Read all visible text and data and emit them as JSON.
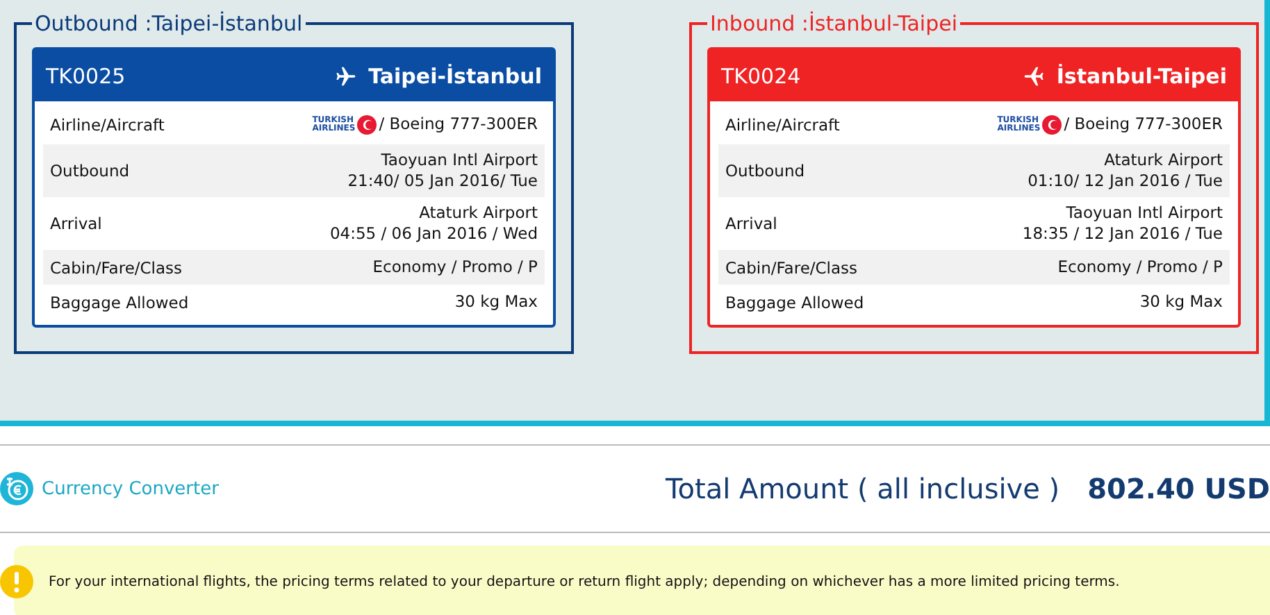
{
  "flights": [
    {
      "kind": "outbound",
      "legend": "Outbound :Taipei-İstanbul",
      "code": "TK0025",
      "route": "Taipei-İstanbul",
      "rows": [
        {
          "label": "Airline/Aircraft",
          "logo": {
            "line1": "TURKISH",
            "line2": "AIRLINES"
          },
          "lines": [
            "/ Boeing 777-300ER"
          ]
        },
        {
          "label": "Outbound",
          "lines": [
            "Taoyuan Intl Airport",
            "21:40/ 05 Jan 2016/ Tue"
          ]
        },
        {
          "label": "Arrival",
          "lines": [
            "Ataturk Airport",
            "04:55 / 06 Jan 2016 / Wed"
          ]
        },
        {
          "label": "Cabin/Fare/Class",
          "lines": [
            "Economy / Promo / P"
          ]
        },
        {
          "label": "Baggage Allowed",
          "lines": [
            "30 kg Max"
          ]
        }
      ]
    },
    {
      "kind": "inbound",
      "legend": "Inbound :İstanbul-Taipei",
      "code": "TK0024",
      "route": "İstanbul-Taipei",
      "rows": [
        {
          "label": "Airline/Aircraft",
          "logo": {
            "line1": "TURKISH",
            "line2": "AIRLINES"
          },
          "lines": [
            "/ Boeing 777-300ER"
          ]
        },
        {
          "label": "Outbound",
          "lines": [
            "Ataturk Airport",
            "01:10/ 12 Jan 2016 / Tue"
          ]
        },
        {
          "label": "Arrival",
          "lines": [
            "Taoyuan Intl Airport",
            "18:35 / 12 Jan 2016 / Tue"
          ]
        },
        {
          "label": "Cabin/Fare/Class",
          "lines": [
            "Economy / Promo / P"
          ]
        },
        {
          "label": "Baggage Allowed",
          "lines": [
            "30 kg Max"
          ]
        }
      ]
    }
  ],
  "currency_converter": "Currency Converter",
  "total": {
    "label": "Total Amount ( all inclusive )",
    "amount": "802.40 USD"
  },
  "notice": "For your international flights, the pricing terms related to your departure or return flight apply; depending on whichever has a more limited pricing terms."
}
